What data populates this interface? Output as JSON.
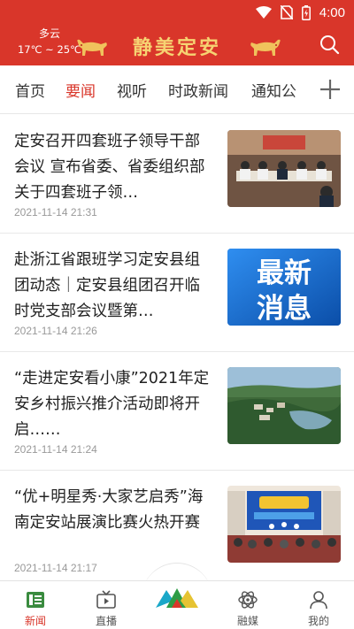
{
  "status_bar": {
    "time": "4:00"
  },
  "header": {
    "weather_condition": "多云",
    "weather_temp": "17℃ ~ 25℃",
    "brand": "静美定安",
    "search_icon": "search-icon",
    "accent_color": "#d9362a"
  },
  "tabs": [
    {
      "label": "首页",
      "active": false
    },
    {
      "label": "要闻",
      "active": true
    },
    {
      "label": "视听",
      "active": false
    },
    {
      "label": "时政新闻",
      "active": false
    },
    {
      "label": "通知公",
      "active": false
    }
  ],
  "news": [
    {
      "title": "定安召开四套班子领导干部会议 宣布省委、省委组织部关于四套班子领…",
      "time": "2021-11-14 21:31"
    },
    {
      "title": "赴浙江省跟班学习定安县组团动态｜定安县组团召开临时党支部会议暨第…",
      "time": "2021-11-14 21:26",
      "thumb_text": [
        "最新",
        "消息"
      ]
    },
    {
      "title": "“走进定安看小康”2021年定安乡村振兴推介活动即将开启……",
      "time": "2021-11-14 21:24"
    },
    {
      "title": "“优+明星秀·大家艺启秀”海南定安站展演比赛火热开赛",
      "time": "2021-11-14 21:17"
    }
  ],
  "bottom_nav": [
    {
      "label": "新闻",
      "icon": "news-icon",
      "active": true
    },
    {
      "label": "直播",
      "icon": "tv-icon",
      "active": false
    },
    {
      "label": "",
      "icon": "app-logo-icon",
      "active": false
    },
    {
      "label": "融媒",
      "icon": "atom-icon",
      "active": false
    },
    {
      "label": "我的",
      "icon": "profile-icon",
      "active": false
    }
  ]
}
